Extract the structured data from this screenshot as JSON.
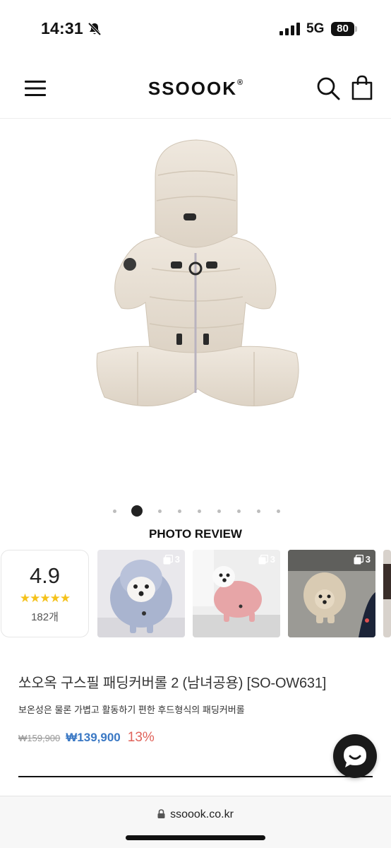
{
  "status_bar": {
    "time": "14:31",
    "network": "5G",
    "battery": "80"
  },
  "header": {
    "logo": "SSOOOK",
    "logo_mark": "®"
  },
  "carousel": {
    "dot_count": 9,
    "active_index": 1
  },
  "photo_review": {
    "title": "PHOTO REVIEW",
    "score": "4.9",
    "stars": "★★★★★",
    "count": "182개",
    "thumbnails": [
      {
        "badge": "3"
      },
      {
        "badge": "3"
      },
      {
        "badge": "3"
      }
    ]
  },
  "product": {
    "title": "쏘오옥 구스필 패딩커버롤 2 (남녀공용) [SO-OW631]",
    "description": "보온성은 물론 가볍고 활동하기 편한 후드형식의 패딩커버롤",
    "price_original": "₩159,900",
    "price_sale": "₩139,900",
    "discount": "13%"
  },
  "browser": {
    "url": "ssoook.co.kr"
  },
  "colors": {
    "sale_price": "#3a78c4",
    "discount": "#e0625a",
    "star": "#f5c21b"
  }
}
